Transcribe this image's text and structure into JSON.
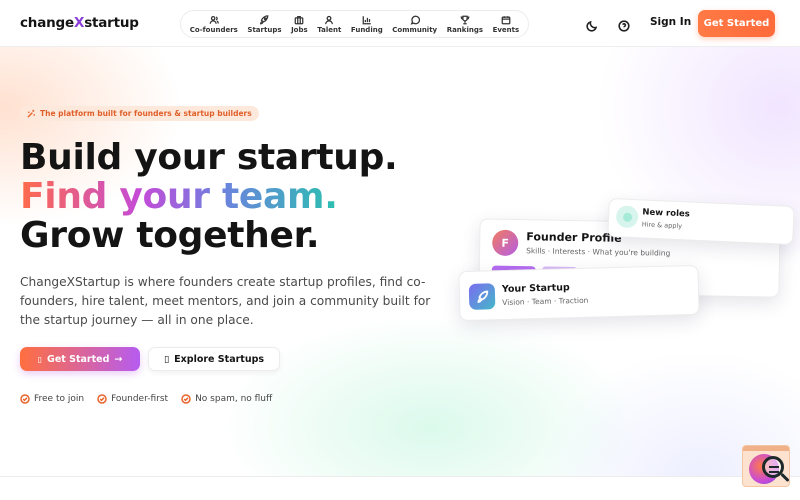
{
  "brand": {
    "prefix": "change",
    "x": "X",
    "suffix": "startup",
    "accent": "#8b3fd9"
  },
  "nav": {
    "items": [
      {
        "label": "Co-founders",
        "icon": "users-icon"
      },
      {
        "label": "Startups",
        "icon": "rocket-icon"
      },
      {
        "label": "Jobs",
        "icon": "briefcase-icon"
      },
      {
        "label": "Talent",
        "icon": "user-icon"
      },
      {
        "label": "Funding",
        "icon": "bar-chart-icon"
      },
      {
        "label": "Community",
        "icon": "chat-bubble-icon"
      },
      {
        "label": "Rankings",
        "icon": "trophy-icon"
      },
      {
        "label": "Events",
        "icon": "calendar-icon"
      }
    ]
  },
  "header": {
    "theme_icon": "moon-icon",
    "help_icon": "help-circle-icon",
    "signin": "Sign In",
    "cta": "Get Started",
    "cta_color": "#ff6f3f"
  },
  "hero": {
    "badge": "The platform built for founders & startup builders",
    "badge_icon": "sparkles-icon",
    "line1": "Build your startup.",
    "line2": "Find your team.",
    "line3": "Grow together.",
    "lead": "ChangeXStartup is where founders create startup profiles, find co-founders, hire talent, meet mentors, and join a community built for the startup journey — all in one place.",
    "primary_icon": "▯",
    "primary": "Get Started",
    "primary_arrow": "→",
    "secondary_icon": "▯",
    "secondary": "Explore Startups",
    "perks": [
      "Free to join",
      "Founder-first",
      "No spam, no fluff"
    ]
  },
  "cards": {
    "founder": {
      "avatar": "F",
      "title": "Founder Profile",
      "sub": "Skills · Interests · What you're building"
    },
    "startup": {
      "title": "Your Startup",
      "sub": "Vision · Team · Traction",
      "icon": "rocket-icon"
    },
    "roles": {
      "title": "New roles",
      "sub": "Hire & apply"
    }
  },
  "widget": {
    "icon": "magnifier-chat-icon"
  }
}
